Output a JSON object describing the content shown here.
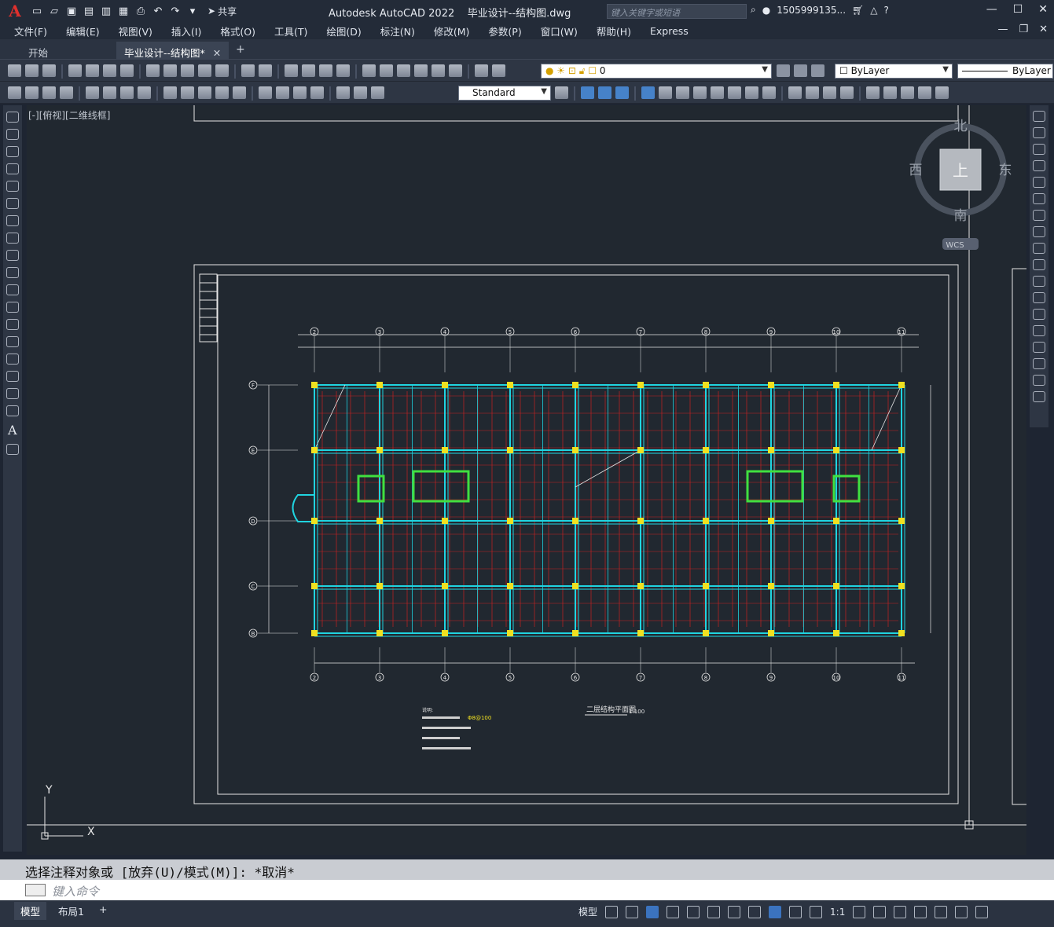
{
  "title": {
    "app_logo": "A",
    "share_label": "共享",
    "app_name": "Autodesk AutoCAD 2022",
    "file_name": "毕业设计--结构图.dwg",
    "search_placeholder": "键入关键字或短语",
    "user": "1505999135...",
    "help": "?"
  },
  "menu": [
    "文件(F)",
    "编辑(E)",
    "视图(V)",
    "插入(I)",
    "格式(O)",
    "工具(T)",
    "绘图(D)",
    "标注(N)",
    "修改(M)",
    "参数(P)",
    "窗口(W)",
    "帮助(H)",
    "Express"
  ],
  "tabs": {
    "start": "开始",
    "active": "毕业设计--结构图*"
  },
  "toolbar": {
    "layer_value": "0",
    "color_value": "ByLayer",
    "linetype_value": "ByLayer",
    "textstyle_value": "Standard"
  },
  "viewport": {
    "label": "[-][俯视][二维线框]"
  },
  "viewcube": {
    "north": "北",
    "south": "南",
    "east": "东",
    "west": "西",
    "top": "上",
    "wcs": "WCS"
  },
  "ucs": {
    "x": "X",
    "y": "Y"
  },
  "drawing": {
    "axis_top": [
      "2",
      "3",
      "4",
      "5",
      "6",
      "7",
      "8",
      "9",
      "10",
      "11"
    ],
    "axis_left": [
      "F",
      "E",
      "D",
      "C",
      "B"
    ],
    "plan_title": "二层结构平面图",
    "plan_scale": "1:100",
    "notes_title": "说明:",
    "notes_highlight": "Φ8@100"
  },
  "command": {
    "history": "选择注释对象或 [放弃(U)/模式(M)]: *取消*",
    "prompt": "键入命令"
  },
  "status": {
    "model_tab": "模型",
    "layout_tab": "布局1",
    "model_label": "模型",
    "scale": "1:1"
  },
  "colors": {
    "column": "#f0e020",
    "beam": "#20d4e0",
    "rebar": "#c82020",
    "frame": "#e6e6e6",
    "opening": "#40e040"
  }
}
